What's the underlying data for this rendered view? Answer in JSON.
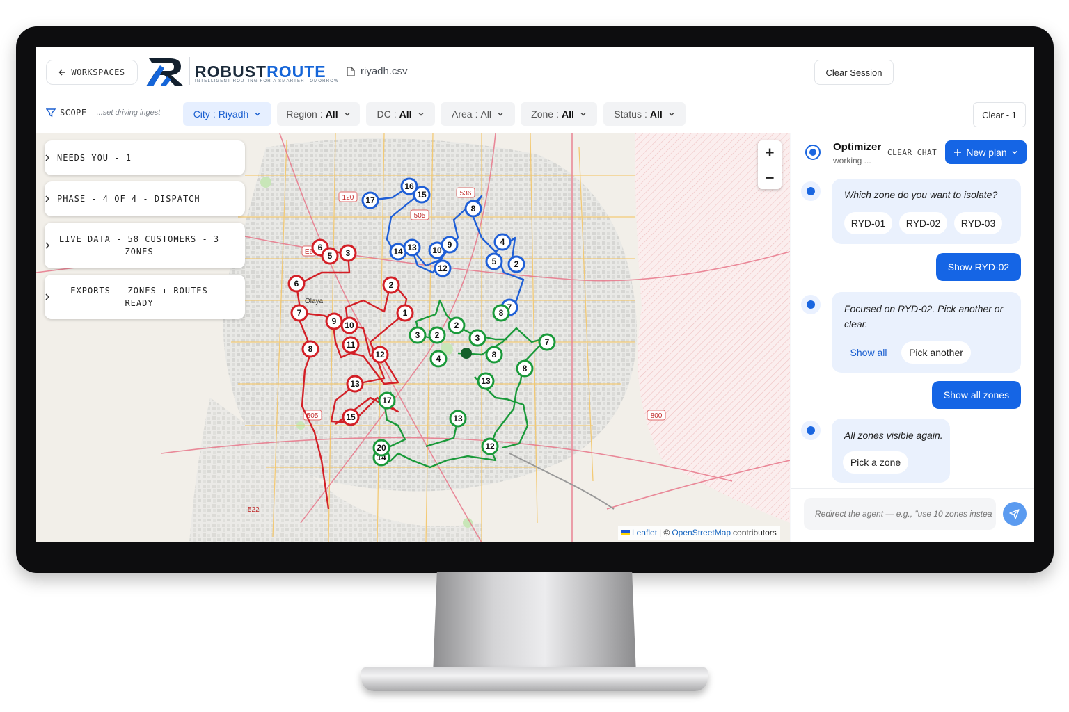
{
  "header": {
    "back_label": "WORKSPACES",
    "brand_left": "ROBUST",
    "brand_right": "ROUTE",
    "tagline": "INTELLIGENT ROUTING FOR A SMARTER TOMORROW",
    "file_name": "riyadh.csv",
    "clear_session_label": "Clear Session"
  },
  "filters": {
    "scope_label": "SCOPE",
    "scope_hint": "...set driving ingest",
    "chips": [
      {
        "key": "City",
        "value": "Riyadh",
        "active": true
      },
      {
        "key": "Region",
        "value": "All",
        "active": false
      },
      {
        "key": "DC",
        "value": "All",
        "active": false
      },
      {
        "key": "Area",
        "value": "All",
        "active": false
      },
      {
        "key": "Zone",
        "value": "All",
        "active": false
      },
      {
        "key": "Status",
        "value": "All",
        "active": false
      }
    ],
    "clear_label": "Clear - 1"
  },
  "side_cards": [
    {
      "label": "NEEDS YOU - 1"
    },
    {
      "label": "PHASE - 4 OF 4 - DISPATCH"
    },
    {
      "label": "LIVE DATA - 58 CUSTOMERS - 3 ZONES"
    },
    {
      "label": "EXPORTS - ZONES + ROUTES READY"
    }
  ],
  "map": {
    "zoom_in": "+",
    "zoom_out": "−",
    "attribution": {
      "leaflet": "Leaflet",
      "sep": "| ©",
      "osm": "OpenStreetMap",
      "suffix": "contributors"
    },
    "road_labels": [
      "120",
      "536",
      "505",
      "E6",
      "505",
      "800",
      "522"
    ],
    "district_label": "Olaya",
    "colors": {
      "red": "#d32027",
      "blue": "#1f5fd6",
      "green": "#1a9a3a"
    },
    "stops": {
      "red": [
        "6",
        "5",
        "3",
        "6",
        "2",
        "1",
        "7",
        "9",
        "10",
        "11",
        "8",
        "12",
        "13",
        "15"
      ],
      "blue": [
        "16",
        "15",
        "17",
        "8",
        "14",
        "13",
        "10",
        "9",
        "12",
        "4",
        "5",
        "2",
        "7"
      ],
      "green": [
        "8",
        "2",
        "3",
        "2",
        "3",
        "4",
        "8",
        "7",
        "8",
        "13",
        "17",
        "13",
        "12",
        "14",
        "20"
      ]
    }
  },
  "chat": {
    "title": "Optimizer",
    "status": "working ...",
    "clear_chat_label": "CLEAR CHAT",
    "new_plan_label": "New plan",
    "messages": [
      {
        "role": "agent",
        "text": "Which zone do you want to isolate?",
        "options": [
          "RYD-01",
          "RYD-02",
          "RYD-03"
        ]
      },
      {
        "role": "user",
        "text": "Show RYD-02"
      },
      {
        "role": "agent",
        "text": "Focused on RYD-02. Pick another or clear.",
        "options": [
          "Show all",
          "Pick another"
        ]
      },
      {
        "role": "user",
        "text": "Show all zones"
      },
      {
        "role": "agent",
        "text": "All zones visible again.",
        "options": [
          "Pick a zone"
        ]
      }
    ],
    "input_placeholder": "Redirect the agent — e.g., \"use 10 zones instea"
  }
}
